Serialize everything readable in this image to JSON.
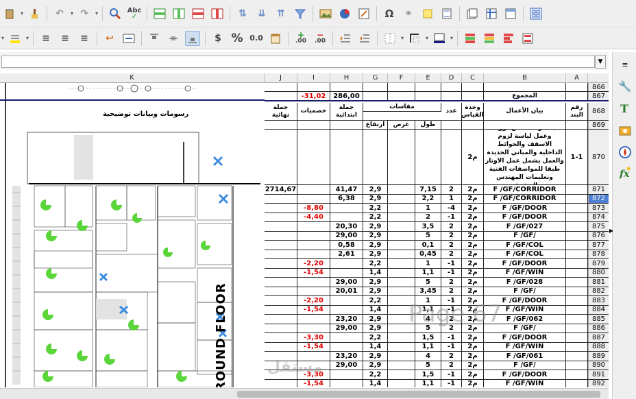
{
  "toolbar_top": {
    "icons": [
      "clipboard-icon",
      "brush-icon",
      "undo-icon",
      "redo-icon",
      "find-replace-icon",
      "spellcheck-icon",
      "insert-row-icon",
      "insert-column-icon",
      "delete-row-icon",
      "delete-column-icon",
      "sort-ascending-icon",
      "sort-descending-icon",
      "sort-icon",
      "autofilter-icon",
      "image-icon",
      "chart-icon",
      "pivot-icon",
      "special-character-icon",
      "hyperlink-icon",
      "comment-icon",
      "header-footer-icon",
      "define-print-area-icon",
      "freeze-icon",
      "split-window-icon",
      "show-draw-functions-icon"
    ],
    "spellcheck_label": "Abc",
    "omega_label": "Ω"
  },
  "toolbar_format": {
    "currency_label": "$",
    "percent_label": "%",
    "number_label": "0.0",
    "add_decimal_label": ".00",
    "delete_decimal_label": ".00"
  },
  "formula_bar": {
    "value": ""
  },
  "columns": [
    {
      "name": "K"
    },
    {
      "name": "J"
    },
    {
      "name": "I"
    },
    {
      "name": "H"
    },
    {
      "name": "G"
    },
    {
      "name": "F"
    },
    {
      "name": "E"
    },
    {
      "name": "D"
    },
    {
      "name": "C"
    },
    {
      "name": "B"
    },
    {
      "name": "A"
    }
  ],
  "sheet": {
    "drawing_title": "رسومات وبيانات توضيحية",
    "ground_floor_label": "ROUND FLOOR",
    "watermark": "Page 67",
    "logo_text": "مستقل",
    "headers": {
      "total_label": "المجموع",
      "final_qty": "جملة نهائية",
      "deductions": "خصميات",
      "initial_qty": "جملة ابتدائية",
      "dimensions": "مقاسات",
      "count": "عدد",
      "unit": "وحدة القياس",
      "description": "بيان الأعمال",
      "item_no": "رقم البند",
      "height": "ارتفاع",
      "width": "عرض",
      "length": "طول"
    },
    "item_870": {
      "description": "بالمتر المسطح توريد وعمل لياسة لزوم الاسقف والحوائط الداخلية والمباني الجديدة والعمل يشمل عمل الاوتار طبقا للمواصفات الفنية وتعليمات المهندس المشرف",
      "unit": "م2",
      "item_no": "1-1"
    },
    "row_867": {
      "deduction": "-31,02",
      "initial": "286,00"
    },
    "rows": [
      {
        "rn": "871",
        "j": "2714,67",
        "i": "",
        "h": "41,47",
        "g": "2,9",
        "e": "7,15",
        "d": "2",
        "c": "م2",
        "b": "F /GF/CORRIDOR"
      },
      {
        "rn": "872",
        "j": "",
        "i": "",
        "h": "6,38",
        "g": "2,9",
        "e": "2,2",
        "d": "1",
        "c": "م2",
        "b": "F /GF/CORRIDOR"
      },
      {
        "rn": "873",
        "j": "",
        "i": "-8,80",
        "h": "",
        "g": "2,2",
        "e": "1",
        "d": "-4",
        "c": "م2",
        "b": "F /GF/DOOR"
      },
      {
        "rn": "874",
        "j": "",
        "i": "-4,40",
        "h": "",
        "g": "2,2",
        "e": "2",
        "d": "-1",
        "c": "م2",
        "b": "F /GF/DOOR"
      },
      {
        "rn": "875",
        "j": "",
        "i": "",
        "h": "20,30",
        "g": "2,9",
        "e": "3,5",
        "d": "2",
        "c": "م2",
        "b": "F /GF/027"
      },
      {
        "rn": "876",
        "j": "",
        "i": "",
        "h": "29,00",
        "g": "2,9",
        "e": "5",
        "d": "2",
        "c": "م2",
        "b": "F /GF/"
      },
      {
        "rn": "877",
        "j": "",
        "i": "",
        "h": "0,58",
        "g": "2,9",
        "e": "0,1",
        "d": "2",
        "c": "م2",
        "b": "F /GF/COL"
      },
      {
        "rn": "878",
        "j": "",
        "i": "",
        "h": "2,61",
        "g": "2,9",
        "e": "0,45",
        "d": "2",
        "c": "م2",
        "b": "F /GF/COL"
      },
      {
        "rn": "879",
        "j": "",
        "i": "-2,20",
        "h": "",
        "g": "2,2",
        "e": "1",
        "d": "-1",
        "c": "م2",
        "b": "F /GF/DOOR"
      },
      {
        "rn": "880",
        "j": "",
        "i": "-1,54",
        "h": "",
        "g": "1,4",
        "e": "1,1",
        "d": "-1",
        "c": "م2",
        "b": "F /GF/WIN"
      },
      {
        "rn": "881",
        "j": "",
        "i": "",
        "h": "29,00",
        "g": "2,9",
        "e": "5",
        "d": "2",
        "c": "م2",
        "b": "F /GF/028"
      },
      {
        "rn": "882",
        "j": "",
        "i": "",
        "h": "20,01",
        "g": "2,9",
        "e": "3,45",
        "d": "2",
        "c": "م2",
        "b": "F /GF/"
      },
      {
        "rn": "883",
        "j": "",
        "i": "-2,20",
        "h": "",
        "g": "2,2",
        "e": "1",
        "d": "-1",
        "c": "م2",
        "b": "F /GF/DOOR"
      },
      {
        "rn": "884",
        "j": "",
        "i": "-1,54",
        "h": "",
        "g": "1,4",
        "e": "1,1",
        "d": "-1",
        "c": "م2",
        "b": "F /GF/WIN"
      },
      {
        "rn": "885",
        "j": "",
        "i": "",
        "h": "23,20",
        "g": "2,9",
        "e": "4",
        "d": "2",
        "c": "م2",
        "b": "F /GF/062"
      },
      {
        "rn": "886",
        "j": "",
        "i": "",
        "h": "29,00",
        "g": "2,9",
        "e": "5",
        "d": "2",
        "c": "م2",
        "b": "F /GF/"
      },
      {
        "rn": "887",
        "j": "",
        "i": "-3,30",
        "h": "",
        "g": "2,2",
        "e": "1,5",
        "d": "-1",
        "c": "م2",
        "b": "F /GF/DOOR"
      },
      {
        "rn": "888",
        "j": "",
        "i": "-1,54",
        "h": "",
        "g": "1,4",
        "e": "1,1",
        "d": "-1",
        "c": "م2",
        "b": "F /GF/WIN"
      },
      {
        "rn": "889",
        "j": "",
        "i": "",
        "h": "23,20",
        "g": "2,9",
        "e": "4",
        "d": "2",
        "c": "م2",
        "b": "F /GF/061"
      },
      {
        "rn": "890",
        "j": "",
        "i": "",
        "h": "29,00",
        "g": "2,9",
        "e": "5",
        "d": "2",
        "c": "م2",
        "b": "F /GF/"
      },
      {
        "rn": "891",
        "j": "",
        "i": "-3,30",
        "h": "",
        "g": "2,2",
        "e": "1,5",
        "d": "-1",
        "c": "م2",
        "b": "F /GF/DOOR"
      },
      {
        "rn": "892",
        "j": "",
        "i": "-1,54",
        "h": "",
        "g": "1,4",
        "e": "1,1",
        "d": "-1",
        "c": "م2",
        "b": "F /GF/WIN"
      }
    ],
    "selected_row": "872",
    "header_rows": {
      "r866": "866",
      "r867": "867",
      "r868": "868",
      "r869": "869",
      "r870": "870"
    }
  },
  "colors": {
    "negative": "#e00000",
    "selected_row": "#4f7fd0",
    "accent_green": "#5bd63a",
    "accent_blue": "#3b8be0"
  }
}
